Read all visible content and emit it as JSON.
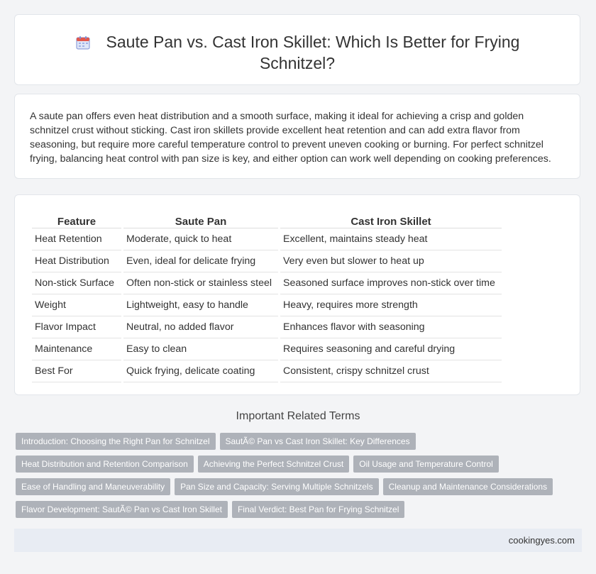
{
  "header": {
    "title": "Saute Pan vs. Cast Iron Skillet: Which Is Better for Frying Schnitzel?",
    "icon": "calendar-icon"
  },
  "summary": {
    "text": "A saute pan offers even heat distribution and a smooth surface, making it ideal for achieving a crisp and golden schnitzel crust without sticking. Cast iron skillets provide excellent heat retention and can add extra flavor from seasoning, but require more careful temperature control to prevent uneven cooking or burning. For perfect schnitzel frying, balancing heat control with pan size is key, and either option can work well depending on cooking preferences."
  },
  "comparison": {
    "headers": [
      "Feature",
      "Saute Pan",
      "Cast Iron Skillet"
    ],
    "rows": [
      [
        "Heat Retention",
        "Moderate, quick to heat",
        "Excellent, maintains steady heat"
      ],
      [
        "Heat Distribution",
        "Even, ideal for delicate frying",
        "Very even but slower to heat up"
      ],
      [
        "Non-stick Surface",
        "Often non-stick or stainless steel",
        "Seasoned surface improves non-stick over time"
      ],
      [
        "Weight",
        "Lightweight, easy to handle",
        "Heavy, requires more strength"
      ],
      [
        "Flavor Impact",
        "Neutral, no added flavor",
        "Enhances flavor with seasoning"
      ],
      [
        "Maintenance",
        "Easy to clean",
        "Requires seasoning and careful drying"
      ],
      [
        "Best For",
        "Quick frying, delicate coating",
        "Consistent, crispy schnitzel crust"
      ]
    ]
  },
  "related": {
    "heading": "Important Related Terms",
    "tags": [
      "Introduction: Choosing the Right Pan for Schnitzel",
      "SautÃ© Pan vs Cast Iron Skillet: Key Differences",
      "Heat Distribution and Retention Comparison",
      "Achieving the Perfect Schnitzel Crust",
      "Oil Usage and Temperature Control",
      "Ease of Handling and Maneuverability",
      "Pan Size and Capacity: Serving Multiple Schnitzels",
      "Cleanup and Maintenance Considerations",
      "Flavor Development: SautÃ© Pan vs Cast Iron Skillet",
      "Final Verdict: Best Pan for Frying Schnitzel"
    ]
  },
  "footer": {
    "site": "cookingyes.com"
  },
  "colors": {
    "tag_bg": "#aeb2b9",
    "footer_bg": "#e8ecf3",
    "page_bg": "#f3f4f6"
  }
}
